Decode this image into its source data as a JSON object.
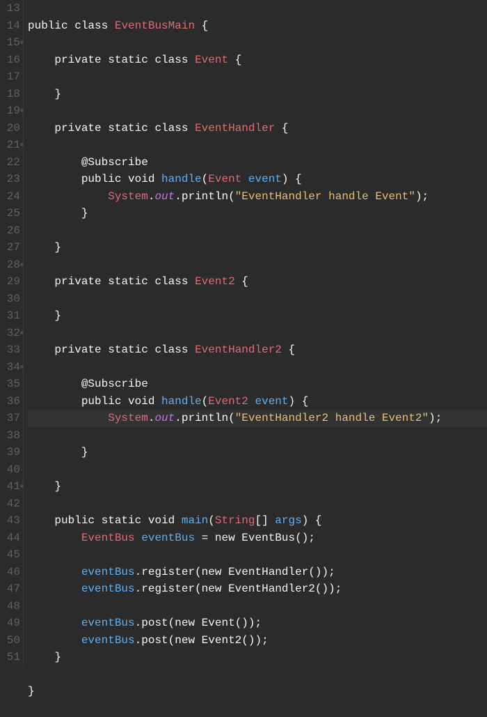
{
  "gutter": {
    "lines": [
      {
        "n": "13",
        "dot": false
      },
      {
        "n": "14",
        "dot": false
      },
      {
        "n": "15",
        "dot": true
      },
      {
        "n": "16",
        "dot": false
      },
      {
        "n": "17",
        "dot": false
      },
      {
        "n": "18",
        "dot": false
      },
      {
        "n": "19",
        "dot": true
      },
      {
        "n": "20",
        "dot": false
      },
      {
        "n": "21",
        "dot": true
      },
      {
        "n": "22",
        "dot": false
      },
      {
        "n": "23",
        "dot": false
      },
      {
        "n": "24",
        "dot": false
      },
      {
        "n": "25",
        "dot": false
      },
      {
        "n": "26",
        "dot": false
      },
      {
        "n": "27",
        "dot": false
      },
      {
        "n": "28",
        "dot": true
      },
      {
        "n": "29",
        "dot": false
      },
      {
        "n": "30",
        "dot": false
      },
      {
        "n": "31",
        "dot": false
      },
      {
        "n": "32",
        "dot": true
      },
      {
        "n": "33",
        "dot": false
      },
      {
        "n": "34",
        "dot": true
      },
      {
        "n": "35",
        "dot": false
      },
      {
        "n": "36",
        "dot": false
      },
      {
        "n": "37",
        "dot": false
      },
      {
        "n": "38",
        "dot": false
      },
      {
        "n": "39",
        "dot": false
      },
      {
        "n": "40",
        "dot": false
      },
      {
        "n": "41",
        "dot": true
      },
      {
        "n": "42",
        "dot": false
      },
      {
        "n": "43",
        "dot": false
      },
      {
        "n": "44",
        "dot": false
      },
      {
        "n": "45",
        "dot": false
      },
      {
        "n": "46",
        "dot": false
      },
      {
        "n": "47",
        "dot": false
      },
      {
        "n": "48",
        "dot": false
      },
      {
        "n": "49",
        "dot": false
      },
      {
        "n": "50",
        "dot": false
      },
      {
        "n": "51",
        "dot": false
      }
    ]
  },
  "tokens": {
    "public": "public",
    "class": "class",
    "private": "private",
    "static": "static",
    "void": "void",
    "new": "new",
    "EventBusMain": "EventBusMain",
    "Event": "Event",
    "EventHandler": "EventHandler",
    "Event2": "Event2",
    "EventHandler2": "EventHandler2",
    "String": "String",
    "EventBus": "EventBus",
    "Subscribe": "@Subscribe",
    "handle": "handle",
    "main": "main",
    "event": "event",
    "args": "args",
    "System": "System",
    "out": "out",
    "println": "println",
    "register": "register",
    "post": "post",
    "eventBus": "eventBus",
    "str1": "\"EventHandler handle Event\"",
    "str2": "\"EventHandler2 handle Event2\"",
    "lbrace": "{",
    "rbrace": "}",
    "lparen": "(",
    "rparen": ")",
    "semi": ";",
    "dot": ".",
    "eq": " = ",
    "brackets": "[]",
    "comma": ", "
  },
  "highlighted_line": 36
}
